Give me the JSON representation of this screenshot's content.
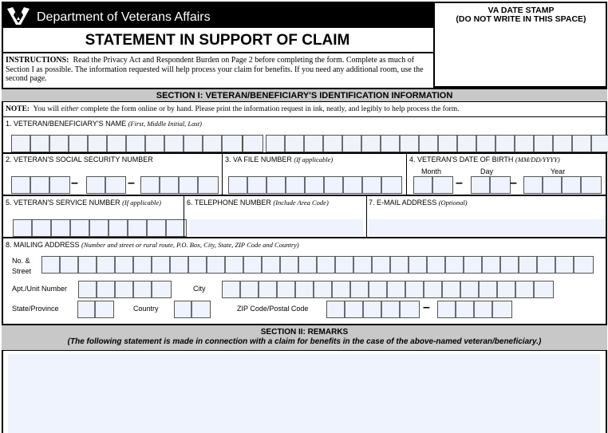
{
  "header": {
    "department": "Department of Veterans Affairs",
    "logo_icon": "va-seal-icon",
    "form_title": "STATEMENT IN SUPPORT OF CLAIM",
    "instructions_label": "INSTRUCTIONS:",
    "instructions_text": "Read the Privacy Act and Respondent Burden on Page 2 before completing the form.  Complete as much of Section I as possible.  The information requested will help process your claim for benefits.  If you need any additional room, use the second page."
  },
  "stamp": {
    "title": "VA DATE STAMP",
    "subtitle": "(DO NOT WRITE IN THIS SPACE)"
  },
  "section1": {
    "title": "SECTION I:  VETERAN/BENEFICIARY'S IDENTIFICATION INFORMATION",
    "note_label": "NOTE:",
    "note_pre": "You will ",
    "note_em": "either",
    "note_post": " complete the form online or by hand.  Please print the information request in ink, neatly, and legibly to help process the form.",
    "fields": {
      "name": {
        "label": "1. VETERAN/BENEFICIARY'S NAME ",
        "hint": "(First, Middle Initial, Last)",
        "first_boxes": 12,
        "middle_boxes": 1,
        "last_boxes": 18,
        "value": ""
      },
      "ssn": {
        "label": "2. VETERAN'S SOCIAL SECURITY NUMBER",
        "groups": [
          3,
          2,
          4
        ],
        "separator": "–",
        "value": ""
      },
      "va_file": {
        "label": "3. VA FILE NUMBER ",
        "hint": "(If applicable)",
        "boxes": 9,
        "value": ""
      },
      "dob": {
        "label": "4. VETERAN'S DATE OF BIRTH ",
        "hint": "(MM/DD/YYYY)",
        "month_label": "Month",
        "day_label": "Day",
        "year_label": "Year",
        "groups": [
          2,
          2,
          4
        ],
        "separator": "–",
        "value": ""
      },
      "service_number": {
        "label": "5. VETERAN'S SERVICE NUMBER ",
        "hint": "(If applicable)",
        "boxes": 9,
        "value": ""
      },
      "telephone": {
        "label": "6. TELEPHONE NUMBER ",
        "hint": "(Include Area Code)",
        "value": ""
      },
      "email": {
        "label": "7. E-MAIL ADDRESS ",
        "hint": "(Optional)",
        "value": ""
      },
      "address": {
        "label": "8. MAILING ADDRESS ",
        "hint": "(Number and street or rural route, P.O. Box, City, State, ZIP Code and Country)",
        "street_label_1": "No. &",
        "street_label_2": "Street",
        "street_boxes": 30,
        "apt_label": "Apt./Unit Number",
        "apt_boxes": 5,
        "city_label": "City",
        "city_boxes": 18,
        "state_label": "State/Province",
        "state_boxes": 2,
        "country_label": "Country",
        "country_boxes": 2,
        "zip_label": "ZIP Code/Postal Code",
        "zip_groups": [
          5,
          4
        ],
        "separator": "–"
      }
    }
  },
  "section2": {
    "title": "SECTION II:  REMARKS",
    "subtitle": "(The following statement is made in connection with a claim for benefits in the case of the above-named veteran/beneficiary.)",
    "remarks_value": ""
  },
  "colors": {
    "field_fill": "#eef3fd",
    "section_header_bg": "#c8c8c8",
    "header_bg": "#000000"
  }
}
